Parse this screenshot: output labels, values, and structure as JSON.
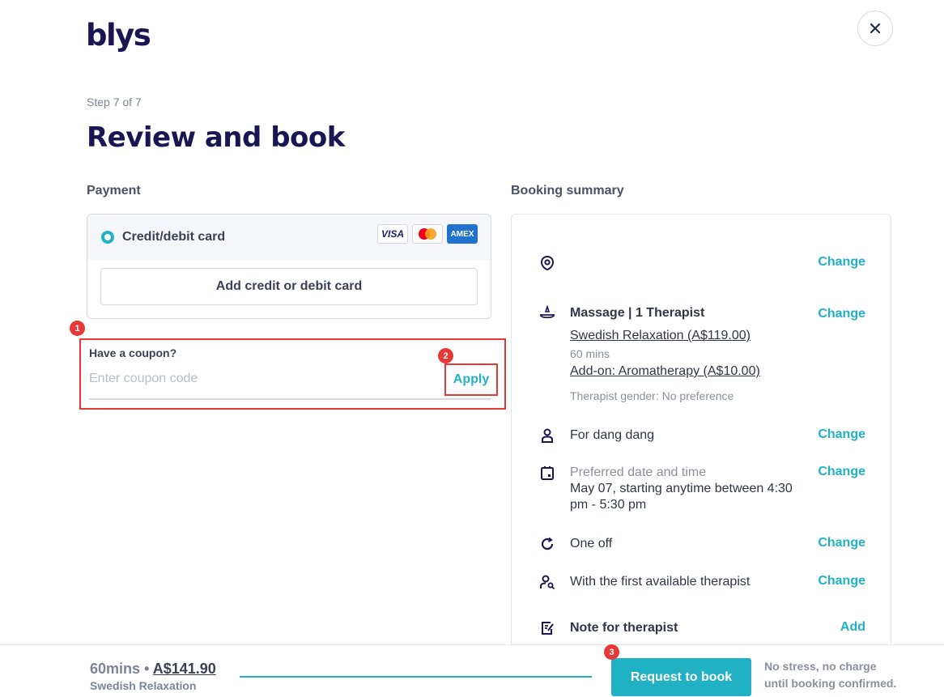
{
  "brand": {
    "logo": "blys"
  },
  "header": {
    "step": "Step 7 of 7",
    "title": "Review and book"
  },
  "payment": {
    "label": "Payment",
    "method": "Credit/debit card",
    "card_brands": [
      "VISA",
      "AMEX"
    ],
    "add_card_label": "Add credit or debit card"
  },
  "coupon": {
    "title": "Have a coupon?",
    "placeholder": "Enter coupon code",
    "apply_label": "Apply"
  },
  "annotations": {
    "badge_1": "1",
    "badge_2": "2",
    "badge_3": "3"
  },
  "summary": {
    "label": "Booking summary",
    "location_action": "Change",
    "service": {
      "title": "Massage | 1 Therapist",
      "treatment": "Swedish Relaxation (A$119.00)",
      "duration": "60 mins",
      "addon": "Add-on: Aromatherapy (A$10.00)",
      "gender": "Therapist gender: No preference",
      "action": "Change"
    },
    "recipient": {
      "text": "For dang dang",
      "action": "Change"
    },
    "datetime": {
      "label": "Preferred date and time",
      "value": "May 07, starting anytime between 4:30 pm - 5:30 pm",
      "action": "Change"
    },
    "frequency": {
      "text": "One off",
      "action": "Change"
    },
    "therapist": {
      "text": "With the first available therapist",
      "action": "Change"
    },
    "note": {
      "text": "Note for therapist",
      "action": "Add"
    }
  },
  "footer": {
    "duration": "60mins",
    "separator": "•",
    "price": "A$141.90",
    "service": "Swedish Relaxation",
    "book_label": "Request to book",
    "note_line1": "No stress, no charge",
    "note_line2": "until booking confirmed."
  },
  "colors": {
    "accent": "#21b1c5",
    "brand": "#1a1654",
    "highlight": "#e53935"
  }
}
